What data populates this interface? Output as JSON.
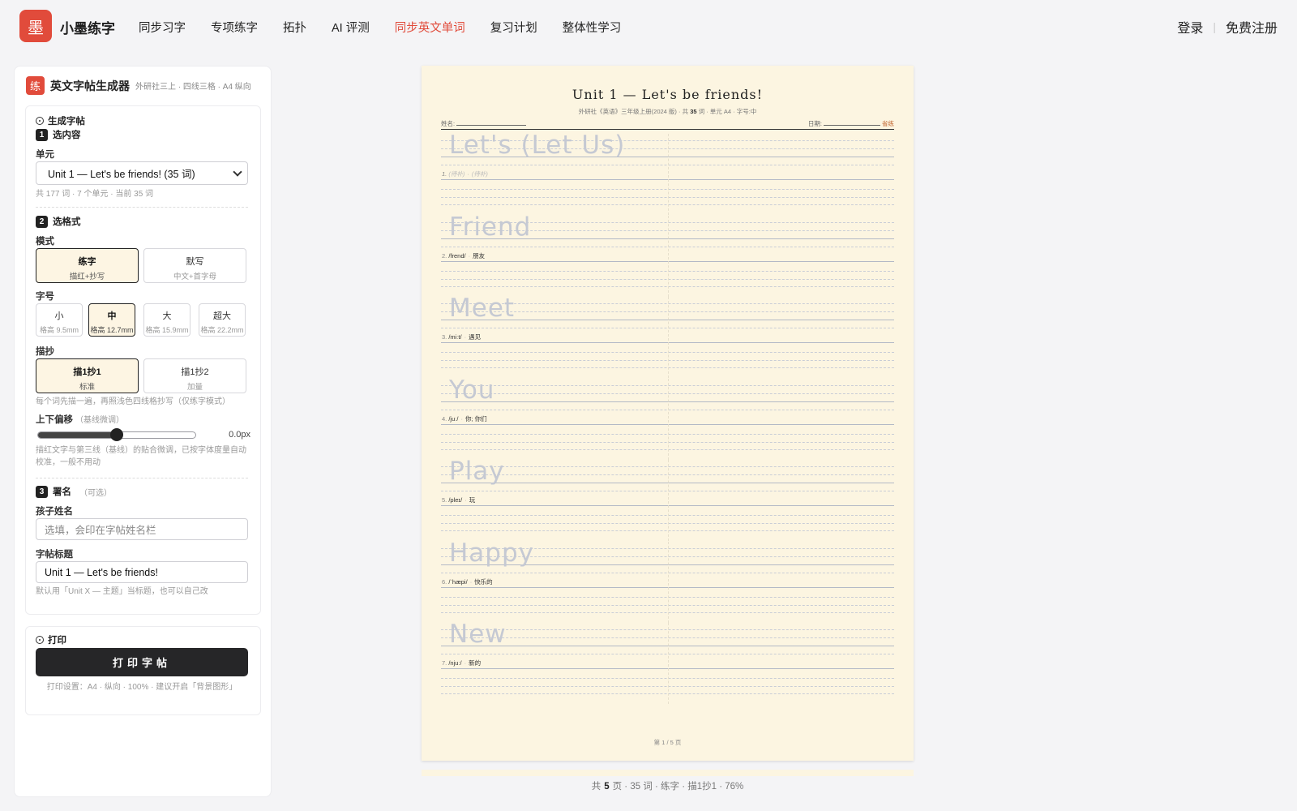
{
  "header": {
    "logo_char": "墨",
    "brand": "小墨练字",
    "nav": [
      {
        "label": "同步习字",
        "active": false
      },
      {
        "label": "专项练字",
        "active": false
      },
      {
        "label": "拓扑",
        "active": false
      },
      {
        "label": "AI 评测",
        "active": false
      },
      {
        "label": "同步英文单词",
        "active": true
      },
      {
        "label": "复习计划",
        "active": false
      },
      {
        "label": "整体性学习",
        "active": false
      }
    ],
    "login": "登录",
    "sep": "|",
    "register": "免费注册"
  },
  "sidebar": {
    "badge": "练",
    "title": "英文字帖生成器",
    "subtitle": "外研社三上 · 四线三格 · A4 纵向",
    "gen_title": "生成字帖",
    "step1": {
      "num": "1",
      "label": "选内容"
    },
    "unit_label": "单元",
    "unit_value": "Unit 1 — Let's be friends! (35 词)",
    "unit_hint": "共 177 词 · 7 个单元 · 当前 35 词",
    "step2": {
      "num": "2",
      "label": "选格式"
    },
    "mode_label": "模式",
    "modes": [
      {
        "a": "练字",
        "b": "描红+抄写",
        "selected": true
      },
      {
        "a": "默写",
        "b": "中文+首字母",
        "selected": false
      }
    ],
    "size_label": "字号",
    "sizes": [
      {
        "a": "小",
        "b": "格高 9.5mm",
        "selected": false
      },
      {
        "a": "中",
        "b": "格高 12.7mm",
        "selected": true
      },
      {
        "a": "大",
        "b": "格高 15.9mm",
        "selected": false
      },
      {
        "a": "超大",
        "b": "格高 22.2mm",
        "selected": false
      }
    ],
    "trace_label": "描抄",
    "traces": [
      {
        "a": "描1抄1",
        "b": "标准",
        "selected": true
      },
      {
        "a": "描1抄2",
        "b": "加量",
        "selected": false
      }
    ],
    "trace_hint": "每个词先描一遍，再照浅色四线格抄写（仅练字模式）",
    "offset_label": "上下偏移",
    "offset_sub": "（基线微调）",
    "offset_fraction": 0.5,
    "offset_value": "0.0px",
    "offset_hint": "描红文字与第三线（基线）的贴合微调，已按字体度量自动校准，一般不用动",
    "step3": {
      "num": "3",
      "label": "署名",
      "optional": "（可选）"
    },
    "name_label": "孩子姓名",
    "name_placeholder": "选填，会印在字帖姓名栏",
    "title_label": "字帖标题",
    "title_value": "Unit 1 — Let's be friends!",
    "title_hint": "默认用「Unit X — 主题」当标题，也可以自己改",
    "print_title": "打印",
    "print_button": "打印字帖",
    "print_hint": "打印设置：A4 · 纵向 · 100% · 建议开启「背景图形」"
  },
  "paper": {
    "title": "Unit 1 — Let's be friends!",
    "meta_pre": "外研社《英语》三年级上册(2024 版)  ·  共",
    "meta_count": "35",
    "meta_post": "词  ·  单元 A4  ·  字号:中",
    "name_label": "姓名:",
    "date_label": "日期:",
    "date_cn": "省练",
    "footer": "第 1 / 5 页",
    "entries": [
      {
        "word": "Let's (Let Us)",
        "num": "1.",
        "ipa": "(待补)",
        "cn": "(待补)",
        "faded": true
      },
      {
        "word": "Friend",
        "num": "2.",
        "ipa": "/frend/",
        "cn": "朋友",
        "faded": false
      },
      {
        "word": "Meet",
        "num": "3.",
        "ipa": "/miːt/",
        "cn": "遇见",
        "faded": false
      },
      {
        "word": "You",
        "num": "4.",
        "ipa": "/juː/",
        "cn": "你; 你们",
        "faded": false
      },
      {
        "word": "Play",
        "num": "5.",
        "ipa": "/pleɪ/",
        "cn": "玩",
        "faded": false
      },
      {
        "word": "Happy",
        "num": "6.",
        "ipa": "/ˈhæpi/",
        "cn": "快乐的",
        "faded": false
      },
      {
        "word": "New",
        "num": "7.",
        "ipa": "/njuː/",
        "cn": "新的",
        "faded": false
      }
    ]
  },
  "status": {
    "pre": "共",
    "pages": "5",
    "post": "页 · 35 词 · 练字 · 描1抄1 ·  76%"
  }
}
